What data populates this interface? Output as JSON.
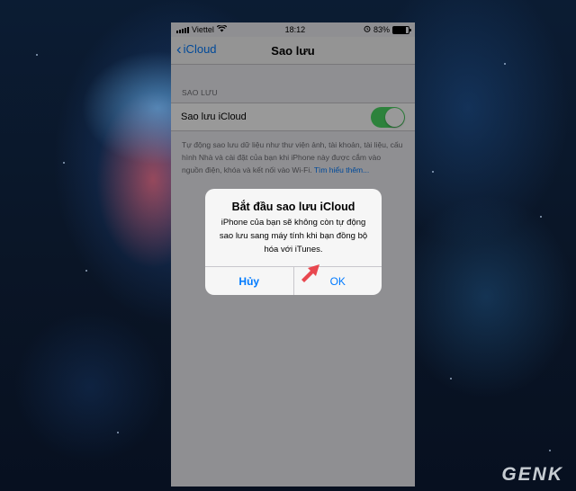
{
  "status_bar": {
    "carrier": "Viettel",
    "time": "18:12",
    "battery": "83%"
  },
  "nav": {
    "back_label": "iCloud",
    "title": "Sao lưu"
  },
  "section": {
    "header": "SAO LƯU",
    "toggle_label": "Sao lưu iCloud",
    "toggle_on": true,
    "footer": "Tự động sao lưu dữ liệu như thư viện ảnh, tài khoản, tài liệu, cấu hình Nhà và cài đặt của bạn khi iPhone này được cắm vào nguồn điện, khóa và kết nối vào Wi-Fi.",
    "footer_link": "Tìm hiểu thêm..."
  },
  "alert": {
    "title": "Bắt đầu sao lưu iCloud",
    "message": "iPhone của bạn sẽ không còn tự động sao lưu sang máy tính khi bạn đồng bộ hóa với iTunes.",
    "cancel_label": "Hủy",
    "ok_label": "OK"
  },
  "colors": {
    "accent": "#007aff",
    "toggle_on": "#4cd964",
    "arrow": "#e8474f"
  },
  "watermark": "GENK"
}
